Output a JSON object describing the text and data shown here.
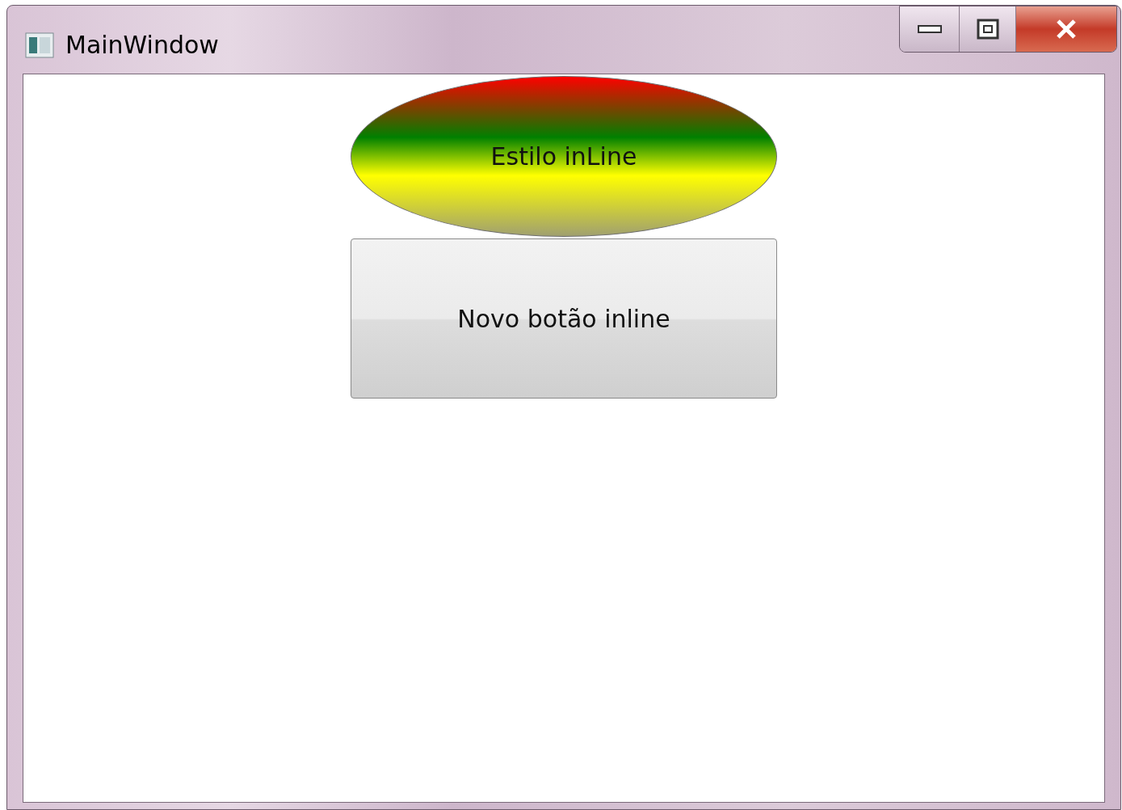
{
  "window": {
    "title": "MainWindow"
  },
  "buttons": [
    {
      "kind": "ellipse",
      "label": "Estilo inLine"
    },
    {
      "kind": "standard",
      "label": "Novo botão inline"
    }
  ]
}
